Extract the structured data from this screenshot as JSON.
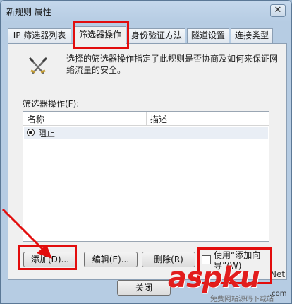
{
  "window": {
    "title": "新规则 属性",
    "close_symbol": "✕"
  },
  "tabs": [
    {
      "label": "IP 筛选器列表",
      "active": false
    },
    {
      "label": "筛选器操作",
      "active": true
    },
    {
      "label": "身份验证方法",
      "active": false
    },
    {
      "label": "隧道设置",
      "active": false
    },
    {
      "label": "连接类型",
      "active": false
    }
  ],
  "panel": {
    "icon": "crossed-swords-icon",
    "description": "选择的筛选器操作指定了此规则是否协商及如何来保证网络流量的安全。",
    "list_label": "筛选器操作(F):",
    "columns": [
      "名称",
      "描述"
    ],
    "rows": [
      {
        "name": "阻止",
        "description": "",
        "selected": true
      }
    ],
    "buttons": {
      "add": "添加(D)...",
      "edit": "编辑(E)...",
      "delete": "删除(R)"
    },
    "wizard_checkbox": {
      "label": "使用“添加向导”(W)",
      "checked": false
    }
  },
  "footer": {
    "close": "关闭"
  },
  "watermark": {
    "brand": "aspku",
    "sub": "免费网站源码下载站",
    "suffix": ".com"
  },
  "edge_text": "Net",
  "colors": {
    "annotation": "#e20d0d",
    "selection": "#e9eef5",
    "title_bar": "#c5d8ec"
  }
}
